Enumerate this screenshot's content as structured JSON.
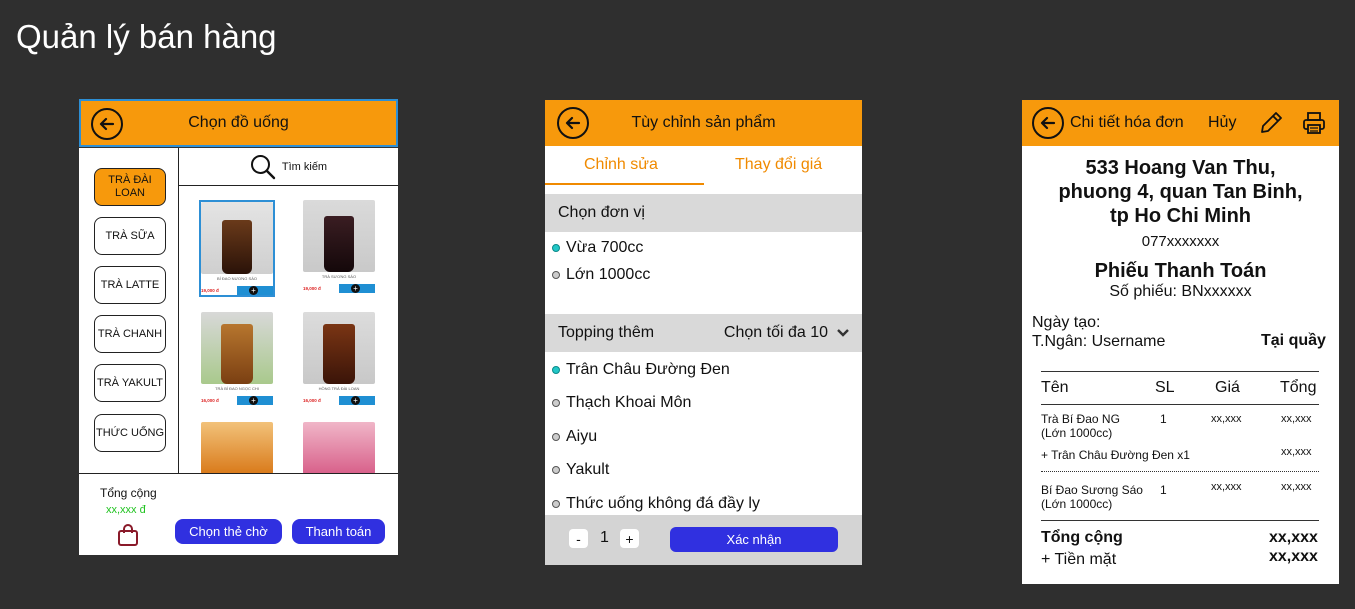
{
  "page_title": "Quản lý bán hàng",
  "screen1": {
    "title": "Chọn đồ uống",
    "categories": [
      "TRÀ ĐÀI LOAN",
      "TRÀ SỮA",
      "TRÀ LATTE",
      "TRÀ CHANH",
      "TRÀ YAKULT",
      "THỨC UỐNG"
    ],
    "search_placeholder": "Tìm kiếm",
    "products": [
      {
        "name": "BÍ ĐAO NƯƠNG SÁO",
        "price": "19,000 đ",
        "color": "#d9d9d9"
      },
      {
        "name": "TRÀ SƯƠNG SÁO",
        "price": "19,000 đ",
        "color": "#d6d6d6"
      },
      {
        "name": "TRÀ BÍ ĐAO NGỌC CHI",
        "price": "16,000 đ",
        "color": "#c8c8c8"
      },
      {
        "name": "HỒNG TRÀ ĐÀI LOAN",
        "price": "16,000 đ",
        "color": "#d2d2d2"
      },
      {
        "name": "",
        "price": "",
        "color": "#e9a23a"
      },
      {
        "name": "",
        "price": "",
        "color": "#e8a4b8"
      }
    ],
    "total_label": "Tổng cộng",
    "total_value": "xx,xxx đ",
    "hold_button": "Chọn thẻ chờ",
    "pay_button": "Thanh toán"
  },
  "screen2": {
    "title": "Tùy chỉnh sản phẩm",
    "tabs": [
      "Chỉnh sửa",
      "Thay đổi giá"
    ],
    "unit_section": "Chọn đơn vị",
    "units": [
      "Vừa 700cc",
      "Lớn 1000cc"
    ],
    "topping_section": "Topping thêm",
    "topping_limit": "Chọn tối đa 10",
    "toppings": [
      "Trân Châu Đường Đen",
      "Thạch Khoai Môn",
      "Aiyu",
      "Yakult",
      "Thức uống không đá đầy ly"
    ],
    "qty_minus": "-",
    "qty": "1",
    "qty_plus": "+",
    "confirm": "Xác nhận"
  },
  "screen3": {
    "title": "Chi tiết hóa đơn",
    "cancel": "Hủy",
    "address": [
      "533 Hoang Van Thu,",
      "phuong 4, quan Tan Binh,",
      "tp Ho Chi Minh"
    ],
    "phone": "077xxxxxxx",
    "receipt_title": "Phiếu Thanh Toán",
    "receipt_no": "Số phiếu: BNxxxxxx",
    "created": "Ngày tạo:",
    "cashier": "T.Ngân: Username",
    "location": "Tại quầy",
    "headers": [
      "Tên",
      "SL",
      "Giá",
      "Tổng"
    ],
    "items": [
      {
        "name": "Trà Bí Đao NG",
        "size": "(Lớn 1000cc)",
        "qty": "1",
        "price": "xx,xxx",
        "total": "xx,xxx"
      },
      {
        "name": "Bí Đao Sương Sáo",
        "size": "(Lớn 1000cc)",
        "qty": "1",
        "price": "xx,xxx",
        "total": "xx,xxx"
      }
    ],
    "topping_line": "+ Trân Châu Đường Đen x1",
    "topping_total": "xx,xxx",
    "sum_label": "Tổng cộng",
    "sum_value": "xx,xxx",
    "cash_label": "+ Tiền mặt",
    "cash_value": "xx,xxx"
  }
}
